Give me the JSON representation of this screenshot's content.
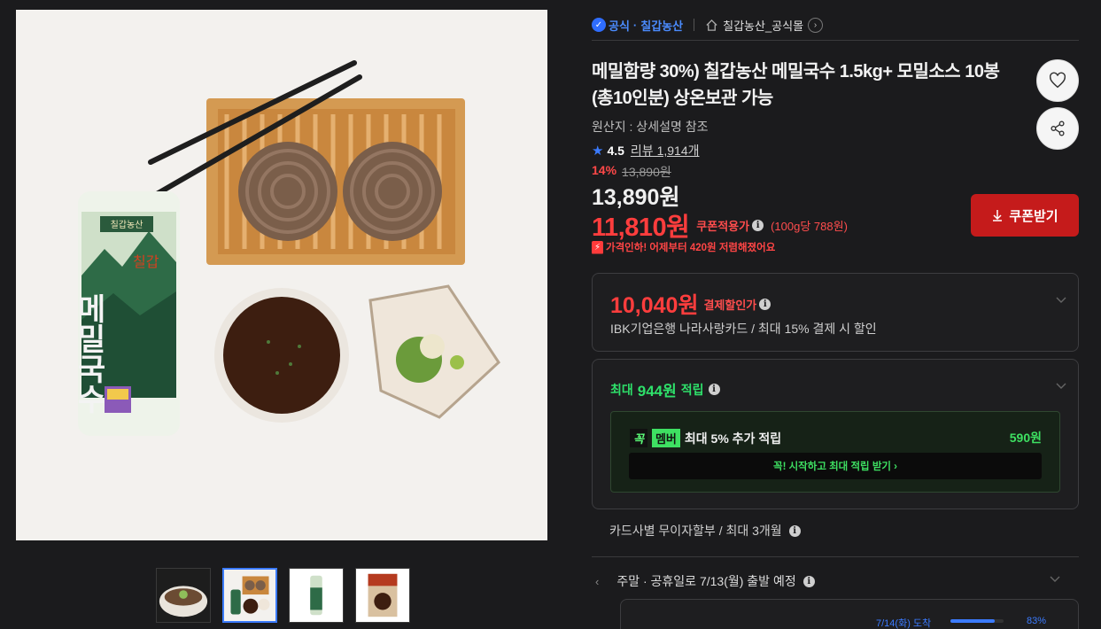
{
  "seller": {
    "official_label": "공식",
    "brand": "칠갑농산",
    "store_name": "칠갑농산_공식몰"
  },
  "product": {
    "title": "메밀함량 30%) 칠갑농산 메밀국수 1.5kg+ 모밀소스 10봉 (총10인분) 상온보관 가능",
    "origin": "원산지 : 상세설명 참조",
    "rating": "4.5",
    "reviews": "리뷰 1,914개"
  },
  "price": {
    "discount_pct": "14%",
    "original": "13,890원",
    "sale": "13,890원",
    "coupon_price": "11,810원",
    "coupon_label": "쿠폰적용가",
    "unit_price": "(100g당 788원)",
    "price_drop": "가격인하! 어제부터 420원 저렴해졌어요"
  },
  "buttons": {
    "coupon": "쿠폰받기"
  },
  "payment_discount": {
    "price": "10,040원",
    "label": "결제할인가",
    "card": "IBK기업은행 나라사랑카드 / 최대 15% 결제 시 할인"
  },
  "rewards": {
    "prefix": "최대",
    "amount": "944원",
    "suffix": "적립",
    "member_logo_a": "꼭",
    "member_logo_b": "멤버",
    "member_text": "최대 5% 추가 적립",
    "member_points": "590원",
    "member_cta": "꼭! 시작하고 최대 적립 받기  ›"
  },
  "installment": "카드사별 무이자할부 / 최대 3개월",
  "delivery": {
    "text": "주말 · 공휴일로 7/13(월) 출발 예정",
    "arrival_label": "7/14(화) 도착",
    "arrival_pct_label": "83%",
    "arrival_fraction": 0.83
  },
  "package_text": {
    "brand": "칠갑농산",
    "name_a": "칠갑",
    "name_b": "메밀국수"
  },
  "colors": {
    "accent_blue": "#3b7bff",
    "price_red": "#ff3d3d",
    "reward_green": "#2ee06a",
    "coupon_btn": "#c51b1b"
  },
  "icons": [
    "official-check-icon",
    "store-home-icon",
    "chevron-right-icon",
    "heart-icon",
    "share-icon",
    "star-icon",
    "info-icon",
    "download-icon",
    "chevron-down-icon"
  ]
}
